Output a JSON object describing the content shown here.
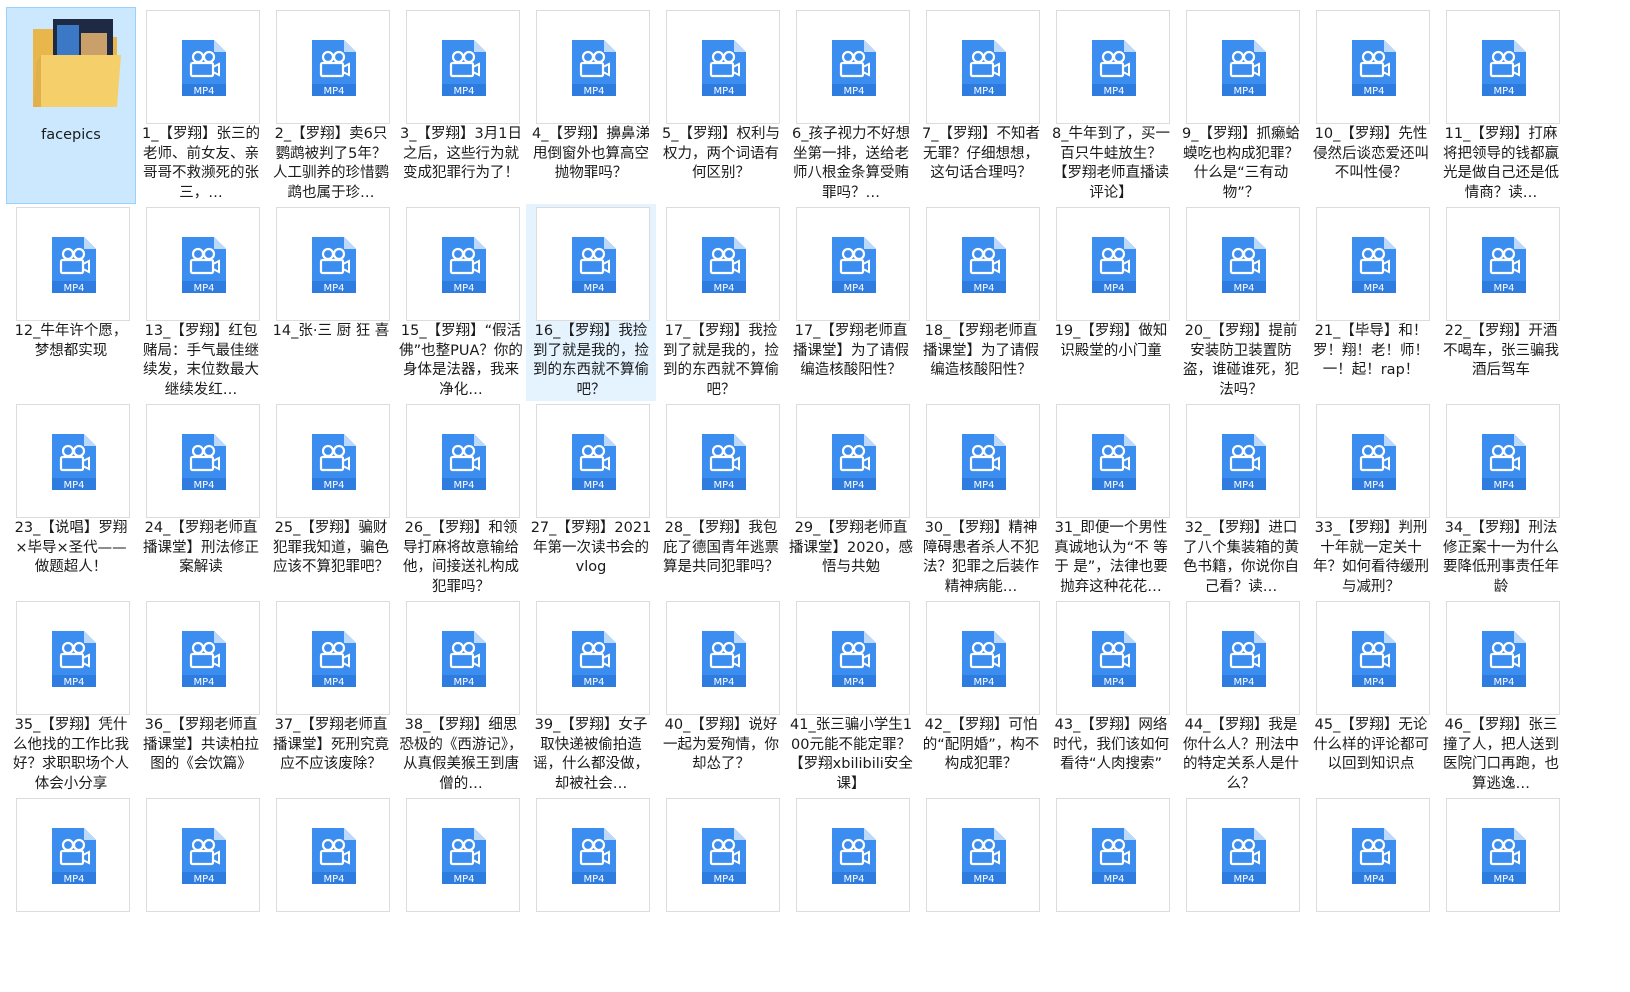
{
  "accent_color": "#3c8df0",
  "selected_color": "#cce8ff",
  "items": [
    {
      "type": "folder",
      "label": "facepics",
      "selected": true,
      "icon": "folder-icon"
    },
    {
      "type": "mp4",
      "label": "1_【罗翔】张三的老师、前女友、亲哥哥不救濒死的张三，…",
      "badge": "MP4",
      "icon": "mp4-file-icon"
    },
    {
      "type": "mp4",
      "label": "2_【罗翔】卖6只鹦鹉被判了5年？人工驯养的珍惜鹦鹉也属于珍…",
      "badge": "MP4",
      "icon": "mp4-file-icon"
    },
    {
      "type": "mp4",
      "label": "3_【罗翔】3月1日之后，这些行为就变成犯罪行为了！",
      "badge": "MP4",
      "icon": "mp4-file-icon"
    },
    {
      "type": "mp4",
      "label": "4_【罗翔】擤鼻涕甩倒窗外也算高空抛物罪吗？",
      "badge": "MP4",
      "icon": "mp4-file-icon"
    },
    {
      "type": "mp4",
      "label": "5_【罗翔】权利与权力，两个词语有何区别？",
      "badge": "MP4",
      "icon": "mp4-file-icon"
    },
    {
      "type": "mp4",
      "label": "6_孩子视力不好想坐第一排，送给老师八根金条算受贿罪吗？…",
      "badge": "MP4",
      "icon": "mp4-file-icon"
    },
    {
      "type": "mp4",
      "label": "7_【罗翔】不知者无罪？仔细想想，这句话合理吗？",
      "badge": "MP4",
      "icon": "mp4-file-icon"
    },
    {
      "type": "mp4",
      "label": "8_牛年到了，买一百只牛蛙放生？【罗翔老师直播读评论】",
      "badge": "MP4",
      "icon": "mp4-file-icon"
    },
    {
      "type": "mp4",
      "label": "9_【罗翔】抓癞蛤蟆吃也构成犯罪？什么是“三有动物”？",
      "badge": "MP4",
      "icon": "mp4-file-icon"
    },
    {
      "type": "mp4",
      "label": "10_【罗翔】先性侵然后谈恋爱还叫不叫性侵？",
      "badge": "MP4",
      "icon": "mp4-file-icon"
    },
    {
      "type": "mp4",
      "label": "11_【罗翔】打麻将把领导的钱都赢光是做自己还是低情商？读…",
      "badge": "MP4",
      "icon": "mp4-file-icon"
    },
    {
      "type": "mp4",
      "label": "12_牛年许个愿，梦想都实现",
      "badge": "MP4",
      "icon": "mp4-file-icon"
    },
    {
      "type": "mp4",
      "label": "13_【罗翔】红包赌局：手气最佳继续发，末位数最大继续发红…",
      "badge": "MP4",
      "icon": "mp4-file-icon"
    },
    {
      "type": "mp4",
      "label": "14_张·三 厨 狂 喜",
      "badge": "MP4",
      "icon": "mp4-file-icon"
    },
    {
      "type": "mp4",
      "label": "15_【罗翔】“假活佛”也整PUA？你的身体是法器，我来净化…",
      "badge": "MP4",
      "icon": "mp4-file-icon"
    },
    {
      "type": "mp4",
      "label": "16_【罗翔】我捡到了就是我的，捡到的东西就不算偷吧？",
      "badge": "MP4",
      "icon": "mp4-file-icon",
      "hover": true
    },
    {
      "type": "mp4",
      "label": "17_【罗翔】我捡到了就是我的，捡到的东西就不算偷吧？",
      "badge": "MP4",
      "icon": "mp4-file-icon"
    },
    {
      "type": "mp4",
      "label": "17_【罗翔老师直播课堂】为了请假编造核酸阳性？",
      "badge": "MP4",
      "icon": "mp4-file-icon"
    },
    {
      "type": "mp4",
      "label": "18_【罗翔老师直播课堂】为了请假编造核酸阳性？",
      "badge": "MP4",
      "icon": "mp4-file-icon"
    },
    {
      "type": "mp4",
      "label": "19_【罗翔】做知识殿堂的小门童",
      "badge": "MP4",
      "icon": "mp4-file-icon"
    },
    {
      "type": "mp4",
      "label": "20_【罗翔】提前安装防卫装置防盗，谁碰谁死，犯法吗？",
      "badge": "MP4",
      "icon": "mp4-file-icon"
    },
    {
      "type": "mp4",
      "label": "21_【毕导】和！罗！翔！老！师！一！起！rap！",
      "badge": "MP4",
      "icon": "mp4-file-icon"
    },
    {
      "type": "mp4",
      "label": "22_【罗翔】开酒不喝车，张三骗我酒后驾车",
      "badge": "MP4",
      "icon": "mp4-file-icon"
    },
    {
      "type": "mp4",
      "label": "23_【说唱】罗翔×毕导×圣代——做题超人！",
      "badge": "MP4",
      "icon": "mp4-file-icon"
    },
    {
      "type": "mp4",
      "label": "24_【罗翔老师直播课堂】刑法修正案解读",
      "badge": "MP4",
      "icon": "mp4-file-icon"
    },
    {
      "type": "mp4",
      "label": "25_【罗翔】骗财犯罪我知道，骗色应该不算犯罪吧？",
      "badge": "MP4",
      "icon": "mp4-file-icon"
    },
    {
      "type": "mp4",
      "label": "26_【罗翔】和领导打麻将故意输给他，间接送礼构成犯罪吗？",
      "badge": "MP4",
      "icon": "mp4-file-icon"
    },
    {
      "type": "mp4",
      "label": "27_【罗翔】2021年第一次读书会的vlog",
      "badge": "MP4",
      "icon": "mp4-file-icon"
    },
    {
      "type": "mp4",
      "label": "28_【罗翔】我包庇了德国青年逃票算是共同犯罪吗？",
      "badge": "MP4",
      "icon": "mp4-file-icon"
    },
    {
      "type": "mp4",
      "label": "29_【罗翔老师直播课堂】2020，感悟与共勉",
      "badge": "MP4",
      "icon": "mp4-file-icon"
    },
    {
      "type": "mp4",
      "label": "30_【罗翔】精神障碍患者杀人不犯法？犯罪之后装作精神病能…",
      "badge": "MP4",
      "icon": "mp4-file-icon"
    },
    {
      "type": "mp4",
      "label": "31_即便一个男性真诚地认为“不 等 于 是”，法律也要抛弃这种花花…",
      "badge": "MP4",
      "icon": "mp4-file-icon"
    },
    {
      "type": "mp4",
      "label": "32_【罗翔】进口了八个集装箱的黄色书籍，你说你自己看？读…",
      "badge": "MP4",
      "icon": "mp4-file-icon"
    },
    {
      "type": "mp4",
      "label": "33_【罗翔】判刑十年就一定关十年？如何看待缓刑与减刑？",
      "badge": "MP4",
      "icon": "mp4-file-icon"
    },
    {
      "type": "mp4",
      "label": "34_【罗翔】刑法修正案十一为什么要降低刑事责任年龄",
      "badge": "MP4",
      "icon": "mp4-file-icon"
    },
    {
      "type": "mp4",
      "label": "35_【罗翔】凭什么他找的工作比我好？求职职场个人体会小分享",
      "badge": "MP4",
      "icon": "mp4-file-icon"
    },
    {
      "type": "mp4",
      "label": "36_【罗翔老师直播课堂】共读柏拉图的《会饮篇》",
      "badge": "MP4",
      "icon": "mp4-file-icon"
    },
    {
      "type": "mp4",
      "label": "37_【罗翔老师直播课堂】死刑究竟应不应该废除？",
      "badge": "MP4",
      "icon": "mp4-file-icon"
    },
    {
      "type": "mp4",
      "label": "38_【罗翔】细思恐极的《西游记》，从真假美猴王到唐僧的…",
      "badge": "MP4",
      "icon": "mp4-file-icon"
    },
    {
      "type": "mp4",
      "label": "39_【罗翔】女子取快递被偷拍造谣，什么都没做，却被社会…",
      "badge": "MP4",
      "icon": "mp4-file-icon"
    },
    {
      "type": "mp4",
      "label": "40_【罗翔】说好一起为爱殉情，你却怂了？",
      "badge": "MP4",
      "icon": "mp4-file-icon"
    },
    {
      "type": "mp4",
      "label": "41_张三骗小学生100元能不能定罪？【罗翔xbilibili安全课】",
      "badge": "MP4",
      "icon": "mp4-file-icon"
    },
    {
      "type": "mp4",
      "label": "42_【罗翔】可怕的“配阴婚”，构不构成犯罪？",
      "badge": "MP4",
      "icon": "mp4-file-icon"
    },
    {
      "type": "mp4",
      "label": "43_【罗翔】网络时代，我们该如何看待“人肉搜索”",
      "badge": "MP4",
      "icon": "mp4-file-icon"
    },
    {
      "type": "mp4",
      "label": "44_【罗翔】我是你什么人？刑法中的特定关系人是什么？",
      "badge": "MP4",
      "icon": "mp4-file-icon"
    },
    {
      "type": "mp4",
      "label": "45_【罗翔】无论什么样的评论都可以回到知识点",
      "badge": "MP4",
      "icon": "mp4-file-icon"
    },
    {
      "type": "mp4",
      "label": "46_【罗翔】张三撞了人，把人送到医院门口再跑，也算逃逸…",
      "badge": "MP4",
      "icon": "mp4-file-icon"
    },
    {
      "type": "mp4",
      "label": "",
      "badge": "MP4",
      "icon": "mp4-file-icon"
    },
    {
      "type": "mp4",
      "label": "",
      "badge": "MP4",
      "icon": "mp4-file-icon"
    },
    {
      "type": "mp4",
      "label": "",
      "badge": "MP4",
      "icon": "mp4-file-icon"
    },
    {
      "type": "mp4",
      "label": "",
      "badge": "MP4",
      "icon": "mp4-file-icon"
    },
    {
      "type": "mp4",
      "label": "",
      "badge": "MP4",
      "icon": "mp4-file-icon"
    },
    {
      "type": "mp4",
      "label": "",
      "badge": "MP4",
      "icon": "mp4-file-icon"
    },
    {
      "type": "mp4",
      "label": "",
      "badge": "MP4",
      "icon": "mp4-file-icon"
    },
    {
      "type": "mp4",
      "label": "",
      "badge": "MP4",
      "icon": "mp4-file-icon"
    },
    {
      "type": "mp4",
      "label": "",
      "badge": "MP4",
      "icon": "mp4-file-icon"
    },
    {
      "type": "mp4",
      "label": "",
      "badge": "MP4",
      "icon": "mp4-file-icon"
    },
    {
      "type": "mp4",
      "label": "",
      "badge": "MP4",
      "icon": "mp4-file-icon"
    },
    {
      "type": "mp4",
      "label": "",
      "badge": "MP4",
      "icon": "mp4-file-icon"
    }
  ]
}
